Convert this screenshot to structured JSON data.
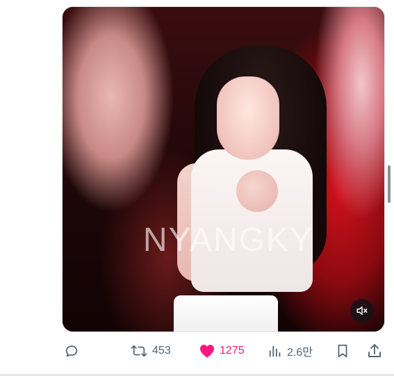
{
  "media": {
    "watermark_text": "NYANGKY",
    "mute_icon": "muted-speaker-icon"
  },
  "actions": {
    "reply": {
      "icon": "reply-bubble-icon",
      "count": ""
    },
    "repost": {
      "icon": "repost-icon",
      "count": "453"
    },
    "like": {
      "icon": "heart-filled-icon",
      "count": "1275",
      "color": "#f91880"
    },
    "views": {
      "icon": "bar-chart-icon",
      "count": "2.6만"
    },
    "bookmark": {
      "icon": "bookmark-icon"
    },
    "share": {
      "icon": "share-upload-icon"
    }
  },
  "colors": {
    "icon_gray": "#536471",
    "like_pink": "#f91880"
  }
}
